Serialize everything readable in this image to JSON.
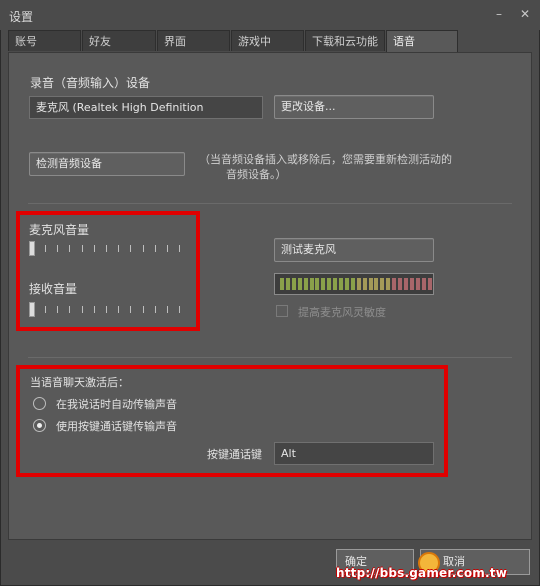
{
  "window": {
    "title": "设置"
  },
  "tabs": [
    {
      "label": "账号"
    },
    {
      "label": "好友"
    },
    {
      "label": "界面"
    },
    {
      "label": "游戏中"
    },
    {
      "label": "下载和云功能"
    },
    {
      "label": "语音"
    }
  ],
  "voice": {
    "record_device_label": "录音（音频输入）设备",
    "record_device_value": "麦克风 (Realtek High Definition",
    "change_device_button": "更改设备...",
    "detect_button": "检测音频设备",
    "detect_note_line1": "（当音频设备插入或移除后，您需要重新检测活动的",
    "detect_note_line2": "音频设备。）",
    "mic_volume_label": "麦克风音量",
    "receive_volume_label": "接收音量",
    "test_mic_button": "测试麦克风",
    "boost_checkbox_label": "提高麦克风灵敏度",
    "after_activate_label": "当语音聊天激活后：",
    "radio_auto": "在我说话时自动传输声音",
    "radio_push": "使用按键通话键传输声音",
    "push_key_label": "按键通话键",
    "push_key_value": "Alt",
    "mic_volume_level": 0.0,
    "receive_volume_level": 0.0,
    "selected_radio": "radio_push"
  },
  "footer": {
    "ok_button": "确定",
    "cancel_button": "取消"
  },
  "watermark": {
    "text": "http://bbs.gamer.com.tw"
  },
  "colors": {
    "highlight_red": "#e00000",
    "meter_green": "#8aa14a"
  },
  "icons": {
    "minimize": "minimize-icon",
    "close": "close-icon"
  }
}
